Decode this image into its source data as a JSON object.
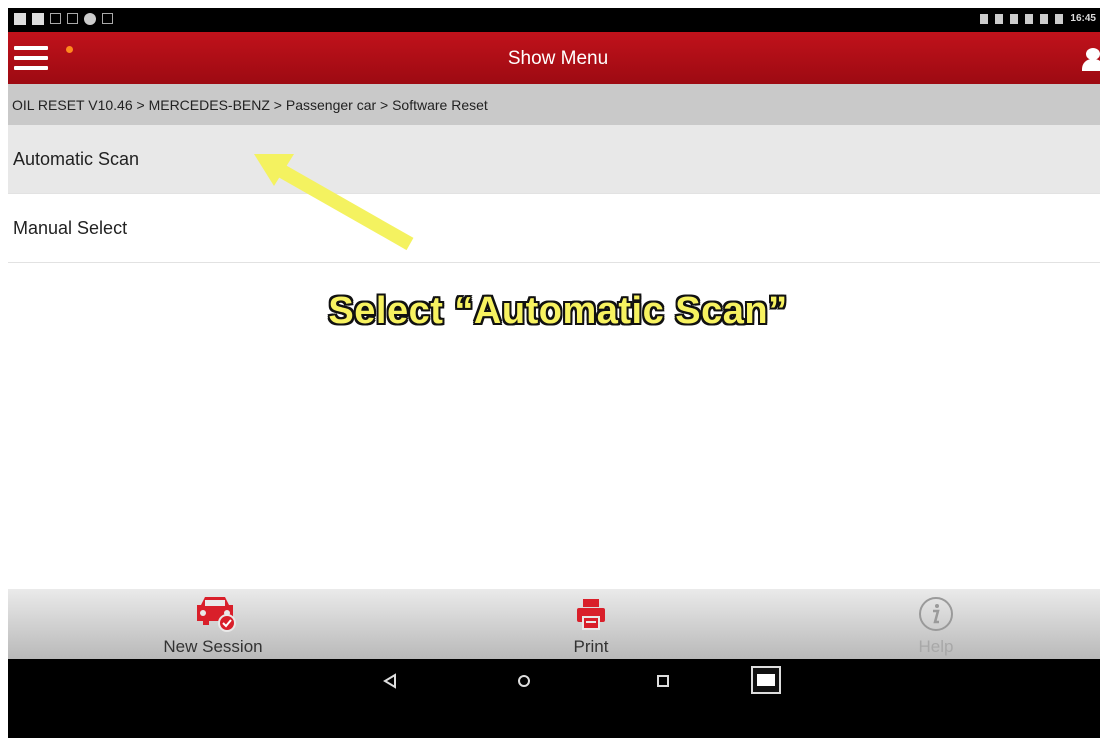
{
  "status_bar": {
    "time": "16:45"
  },
  "header": {
    "title": "Show Menu"
  },
  "breadcrumb": "OIL RESET V10.46 > MERCEDES-BENZ > Passenger car > Software Reset",
  "menu": {
    "items": [
      {
        "label": "Automatic Scan",
        "highlighted": true
      },
      {
        "label": "Manual Select",
        "highlighted": false
      }
    ]
  },
  "annotation": {
    "caption": "Select “Automatic Scan”"
  },
  "toolbar": {
    "new_session": "New Session",
    "print": "Print",
    "help": "Help"
  },
  "colors": {
    "brand_red": "#b0101a",
    "annotation_yellow": "#f7f260",
    "disabled_gray": "#a8a8a8"
  },
  "icons": {
    "menu": "hamburger-icon",
    "user": "user-icon",
    "new_session": "car-check-icon",
    "print": "printer-icon",
    "help": "info-icon",
    "back": "back-triangle-icon",
    "home": "home-circle-icon",
    "recent": "recent-square-icon"
  }
}
